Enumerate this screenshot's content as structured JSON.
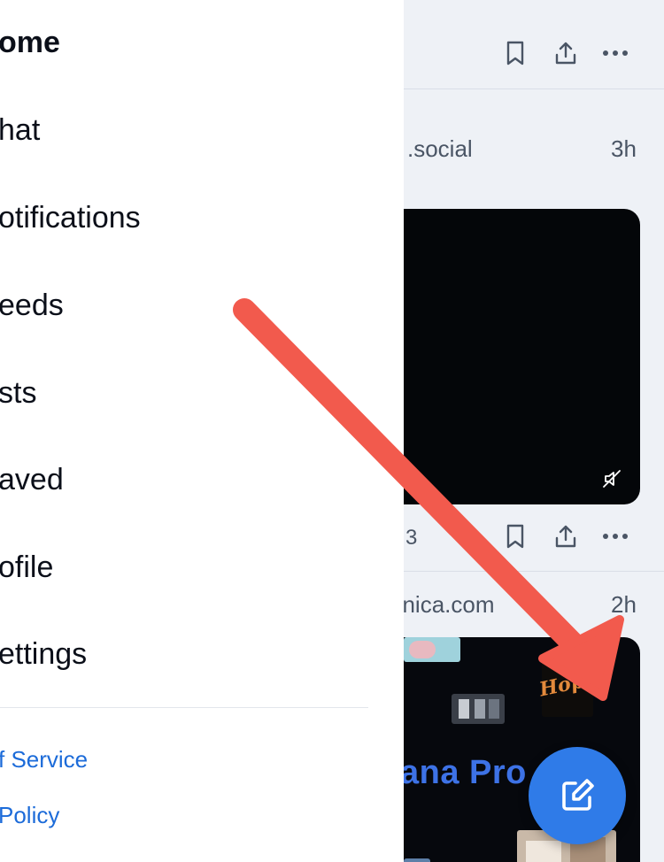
{
  "drawer": {
    "nav_items": [
      {
        "label": "ome"
      },
      {
        "label": "hat"
      },
      {
        "label": "otifications"
      },
      {
        "label": "eeds"
      },
      {
        "label": "sts"
      },
      {
        "label": "aved"
      },
      {
        "label": "ofile"
      },
      {
        "label": "ettings"
      }
    ],
    "footer_links": [
      {
        "label": "f Service"
      },
      {
        "label": "Policy"
      }
    ]
  },
  "feed": {
    "post1": {
      "handle": ".social",
      "time": "3h",
      "count": "3"
    },
    "post2": {
      "handle": "nnica.com",
      "time": "2h",
      "media_text": "ana Pro",
      "media_sticker": "Hope"
    }
  },
  "icons": {
    "bookmark": "bookmark-icon",
    "share": "share-icon",
    "more": "more-icon",
    "mute": "muted-speaker-icon",
    "compose": "compose-icon"
  },
  "colors": {
    "accent": "#2f7be8",
    "link": "#1c6bd9",
    "annotation_arrow": "#f25a4d",
    "feed_bg": "#eef1f6"
  }
}
